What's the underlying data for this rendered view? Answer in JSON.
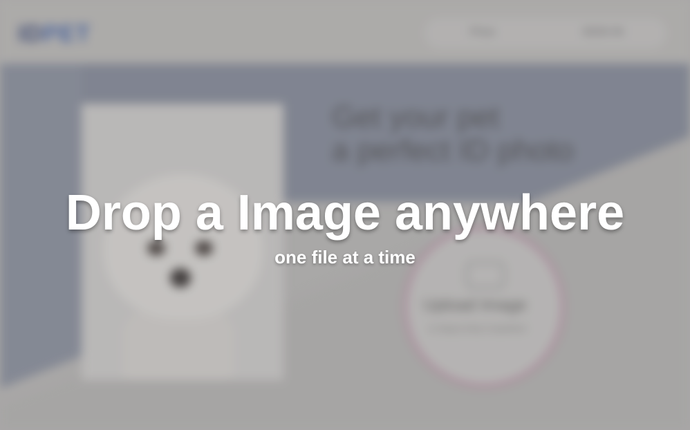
{
  "background": {
    "logo": {
      "part1": "ID",
      "part2": "PET"
    },
    "nav": {
      "item1": "Price",
      "item2": "SIGN IN"
    },
    "hero": {
      "title_line1": "Get your pet",
      "title_line2": "a perfect ID photo"
    },
    "upload": {
      "title": "Upload Image",
      "subtitle": "or drag & drop it anywhere"
    }
  },
  "overlay": {
    "title": "Drop a Image anywhere",
    "subtitle": "one file at a time"
  },
  "colors": {
    "overlay_text": "#ffffff",
    "brand_dark": "#2f3f73",
    "brand_light": "#3e5fa8",
    "hero_blue": "#808697",
    "upload_ring": "#b97a9c"
  },
  "icons": {
    "upload": "upload-icon"
  }
}
